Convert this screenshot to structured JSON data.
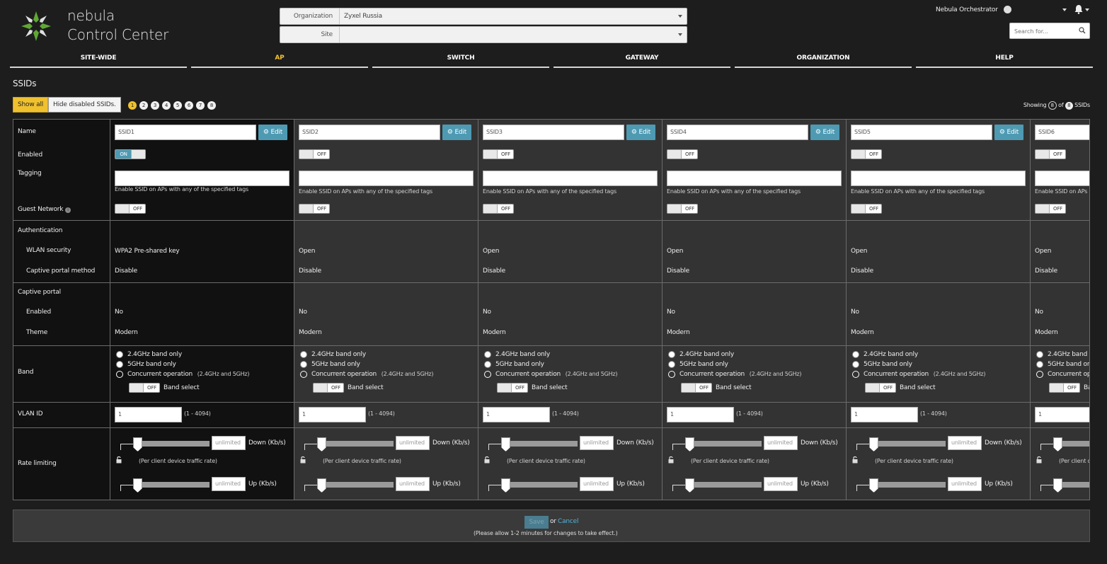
{
  "app": {
    "title_line1": "nebula",
    "title_line2": "Control Center"
  },
  "header": {
    "org_label": "Organization",
    "org_value": "Zyxel Russia",
    "site_label": "Site",
    "site_value": "",
    "account": "Nebula Orchestrator",
    "search_placeholder": "Search for..."
  },
  "nav": [
    {
      "label": "SITE-WIDE"
    },
    {
      "label": "AP"
    },
    {
      "label": "SWITCH"
    },
    {
      "label": "GATEWAY"
    },
    {
      "label": "ORGANIZATION"
    },
    {
      "label": "HELP"
    }
  ],
  "page_title": "SSIDs",
  "toolbar": {
    "show_all": "Show all",
    "hide_disabled": "Hide disabled SSIDs.",
    "pages": [
      "1",
      "2",
      "3",
      "4",
      "5",
      "6",
      "7",
      "8"
    ],
    "showing_prefix": "Showing",
    "showing_count": "8",
    "showing_of": "of",
    "showing_total": "8",
    "showing_suffix": "SSIDs"
  },
  "row_labels": {
    "name": "Name",
    "enabled": "Enabled",
    "tagging": "Tagging",
    "guest": "Guest Network",
    "auth": "Authentication",
    "wlan": "WLAN security",
    "captive_method": "Captive portal method",
    "captive": "Captive portal",
    "cp_enabled": "Enabled",
    "theme": "Theme",
    "band": "Band",
    "vlan": "VLAN ID",
    "rate": "Rate limiting"
  },
  "common": {
    "edit": "Edit",
    "tag_hint": "Enable SSID on APs with any of the specified tags",
    "band_24": "2.4GHz band only",
    "band_5": "5GHz band only",
    "band_conc": "Concurrent operation",
    "band_conc_note": "(2.4GHz and 5GHz)",
    "band_select": "Band select",
    "vlan_range": "(1 - 4094)",
    "unlimited": "unlimited",
    "down": "Down (Kb/s)",
    "up": "Up (Kb/s)",
    "per_client": "(Per client device traffic rate)",
    "on": "ON",
    "off": "OFF"
  },
  "ssids": [
    {
      "name": "SSID1",
      "enabled": true,
      "wlan": "WPA2 Pre-shared key",
      "captive_method": "Disable",
      "cp_enabled": "No",
      "theme": "Modern",
      "vlan": "1"
    },
    {
      "name": "SSID2",
      "enabled": false,
      "wlan": "Open",
      "captive_method": "Disable",
      "cp_enabled": "No",
      "theme": "Modern",
      "vlan": "1"
    },
    {
      "name": "SSID3",
      "enabled": false,
      "wlan": "Open",
      "captive_method": "Disable",
      "cp_enabled": "No",
      "theme": "Modern",
      "vlan": "1"
    },
    {
      "name": "SSID4",
      "enabled": false,
      "wlan": "Open",
      "captive_method": "Disable",
      "cp_enabled": "No",
      "theme": "Modern",
      "vlan": "1"
    },
    {
      "name": "SSID5",
      "enabled": false,
      "wlan": "Open",
      "captive_method": "Disable",
      "cp_enabled": "No",
      "theme": "Modern",
      "vlan": "1"
    },
    {
      "name": "SSID6",
      "enabled": false,
      "wlan": "Open",
      "captive_method": "Disable",
      "cp_enabled": "No",
      "theme": "Modern",
      "vlan": "1"
    }
  ],
  "footer": {
    "save": "Save",
    "or": "or",
    "cancel": "Cancel",
    "note": "(Please allow 1-2 minutes for changes to take effect.)"
  },
  "colors": {
    "accent": "#4e9ab3",
    "active_tab": "#f0c12e",
    "background": "#1d1d1d"
  }
}
